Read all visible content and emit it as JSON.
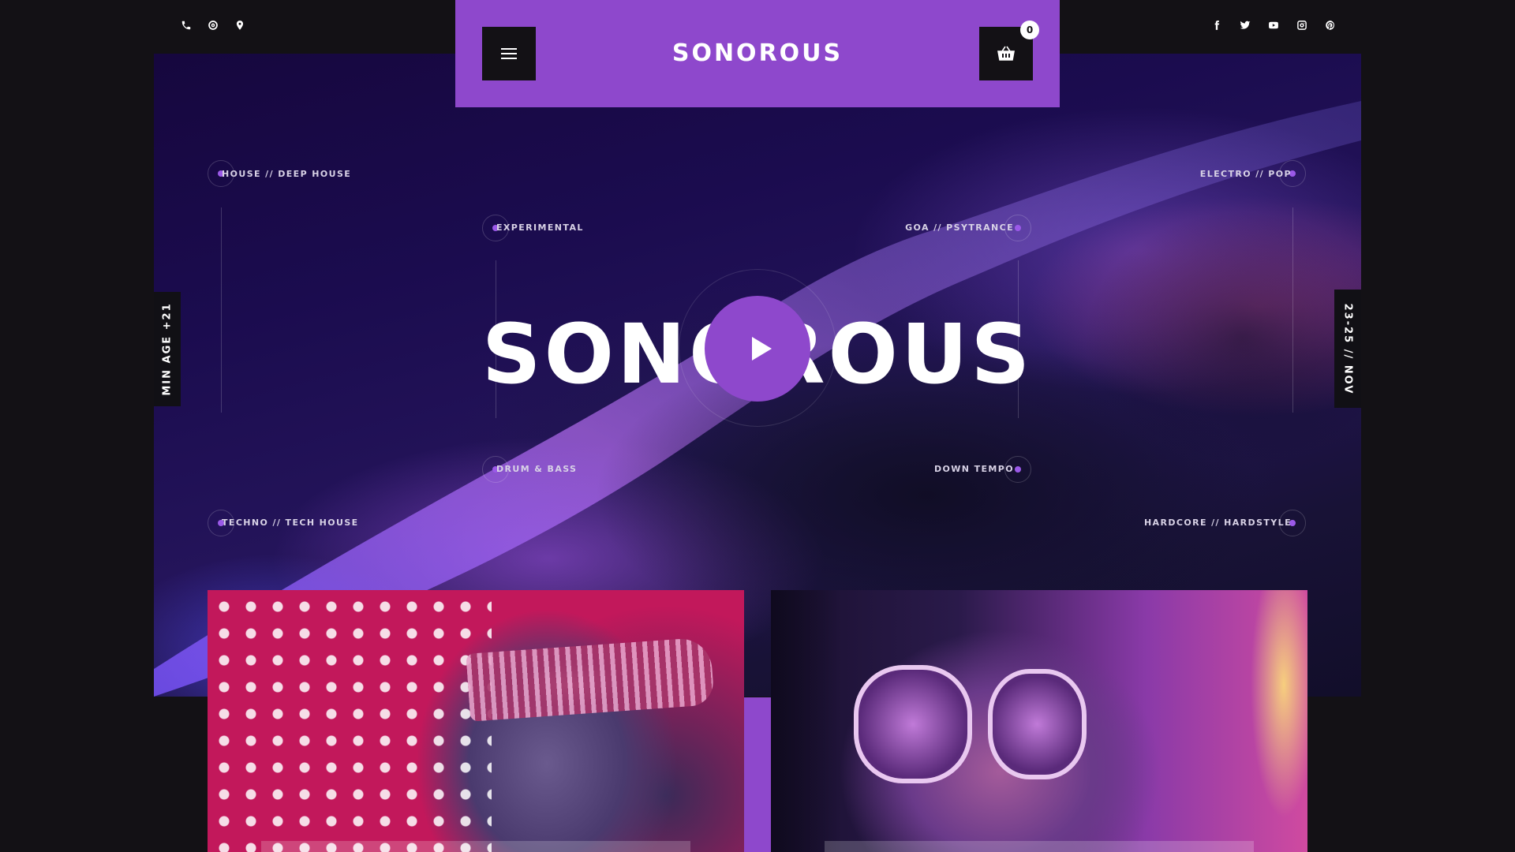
{
  "brand": {
    "name": "SONOROUS",
    "accent": "#8e48cc",
    "background": "#131115"
  },
  "header": {
    "logo": "SONOROUS",
    "menu_icon": "hamburger-icon",
    "cart_icon": "basket-icon",
    "cart_count": "0"
  },
  "utility_left": [
    "phone-icon",
    "target-icon",
    "location-pin-icon"
  ],
  "social": [
    "facebook-icon",
    "twitter-icon",
    "youtube-icon",
    "instagram-icon",
    "pinterest-icon"
  ],
  "hero": {
    "title": "SONOROUS",
    "play_icon": "play-icon",
    "side_left": "MIN AGE +21",
    "side_right": "23-25 // NOV",
    "genres": {
      "house": "HOUSE // DEEP HOUSE",
      "experimental": "EXPERIMENTAL",
      "goa": "GOA // PSYTRANCE",
      "electro": "ELECTRO // POP",
      "drum": "DRUM & BASS",
      "downtempo": "DOWN TEMPO",
      "techno": "TECHNO // TECH HOUSE",
      "hardcore": "HARDCORE // HARDSTYLE"
    }
  }
}
